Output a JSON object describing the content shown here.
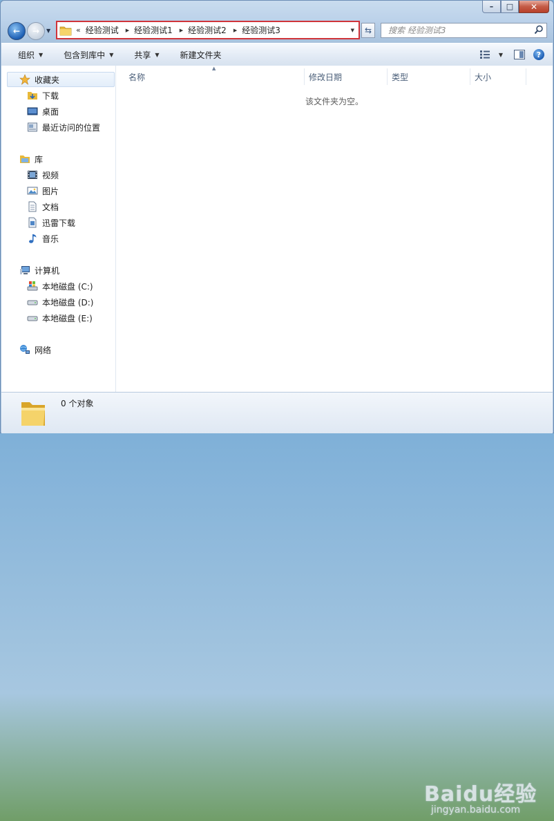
{
  "window": {
    "caption": {
      "minimize_glyph": "–",
      "maximize_glyph": "□",
      "close_glyph": "✕"
    }
  },
  "nav": {
    "back_glyph": "←",
    "forward_glyph": "→",
    "history_glyph": "▼"
  },
  "address": {
    "overflow_glyph": "«",
    "crumbs": [
      "经验测试",
      "经验测试1",
      "经验测试2",
      "经验测试3"
    ],
    "separator_glyph": "▶",
    "dropdown_glyph": "▼",
    "refresh_glyph": "⇆"
  },
  "search": {
    "placeholder": "搜索 经验测试3"
  },
  "toolbar": {
    "organize": "组织",
    "include_in_library": "包含到库中",
    "share": "共享",
    "new_folder": "新建文件夹",
    "dropdown_glyph": "▼",
    "help_glyph": "?"
  },
  "sidebar": {
    "favorites": {
      "header": "收藏夹",
      "items": [
        "下载",
        "桌面",
        "最近访问的位置"
      ]
    },
    "libraries": {
      "header": "库",
      "items": [
        "视频",
        "图片",
        "文档",
        "迅雷下载",
        "音乐"
      ]
    },
    "computer": {
      "header": "计算机",
      "items": [
        "本地磁盘 (C:)",
        "本地磁盘 (D:)",
        "本地磁盘 (E:)"
      ]
    },
    "network": {
      "header": "网络"
    }
  },
  "columns": {
    "name": "名称",
    "date_modified": "修改日期",
    "type": "类型",
    "size": "大小",
    "sort_glyph": "▲"
  },
  "content": {
    "empty_message": "该文件夹为空。"
  },
  "details": {
    "count": "0 个对象"
  },
  "watermark": {
    "logo_text": "Baidu经验",
    "url": "jingyan.baidu.com"
  },
  "colors": {
    "address_highlight": "#d0343a",
    "accent_blue": "#1d5fb4",
    "folder_yellow": "#f3c84a"
  }
}
